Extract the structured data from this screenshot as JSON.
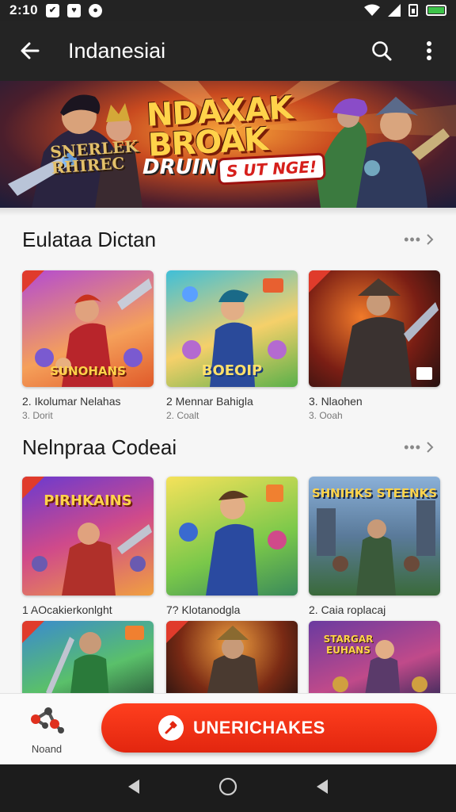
{
  "status_bar": {
    "time": "2:10"
  },
  "app_bar": {
    "title": "Indanesiai"
  },
  "banner": {
    "title_line1": "NDAXAK",
    "title_line2": "BROAK",
    "left_line1": "SNERLEK",
    "left_line2": "RHIREC",
    "subtitle": "DRUIN",
    "tag": "S UT NGE!"
  },
  "section1": {
    "title": "Eulataa Dictan",
    "items": [
      {
        "title": "2. Ikolumar Nelahas",
        "sub": "3. Dorit",
        "label": "SUNOHANS"
      },
      {
        "title": "2  Mennar Bahigla",
        "sub": "2. Coalt",
        "label": "BOEOIP"
      },
      {
        "title": "3. Nlaohen",
        "sub": "3. Ooah"
      }
    ]
  },
  "section2": {
    "title": "Nelnpraa Codeai",
    "items": [
      {
        "title": "1 AOcakierkonlght",
        "label": "PIRHKAINS"
      },
      {
        "title": "7? Klotanodgla"
      },
      {
        "title": "2. Caia roplacaj",
        "label": "SHNIHKS STEENKS"
      },
      {
        "label": ""
      },
      {
        "label": ""
      },
      {
        "label": "STARGAR EUHANS"
      }
    ]
  },
  "bottom_bar": {
    "profile_label": "Noand",
    "cta_label": "UNERICHAKES"
  }
}
